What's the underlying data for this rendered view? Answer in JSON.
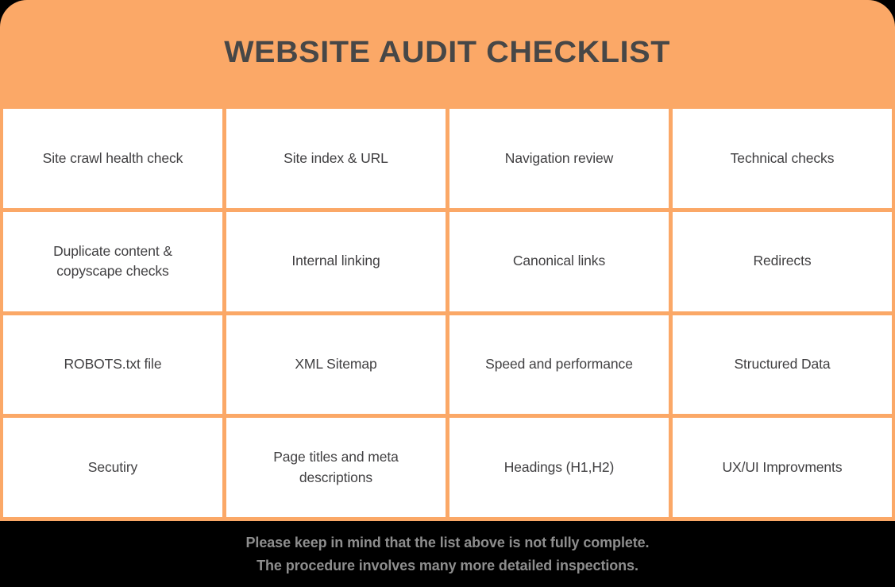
{
  "header": {
    "title": "WEBSITE AUDIT CHECKLIST",
    "background_color": "#FBA867",
    "title_color": "#474747"
  },
  "grid": {
    "columns": 4,
    "rows": 4,
    "cell_background": "#FFFFFF",
    "line_color": "#FBA867",
    "text_color": "#414042",
    "items": [
      {
        "label": "Site crawl health check"
      },
      {
        "label": "Site index & URL"
      },
      {
        "label": "Navigation review"
      },
      {
        "label": "Technical checks"
      },
      {
        "label": "Duplicate content &\ncopyscape checks"
      },
      {
        "label": "Internal linking"
      },
      {
        "label": "Canonical links"
      },
      {
        "label": "Redirects"
      },
      {
        "label": "ROBOTS.txt file"
      },
      {
        "label": "XML Sitemap"
      },
      {
        "label": "Speed and performance"
      },
      {
        "label": "Structured Data"
      },
      {
        "label": "Secutiry"
      },
      {
        "label": "Page titles and meta\ndescriptions"
      },
      {
        "label": "Headings (H1,H2)"
      },
      {
        "label": "UX/UI Improvments"
      }
    ]
  },
  "footer": {
    "background_color": "#000000",
    "text_color": "#8E8E8E",
    "line1": "Please keep in mind that the list above is not fully complete.",
    "line2": "The procedure involves many more detailed inspections."
  }
}
